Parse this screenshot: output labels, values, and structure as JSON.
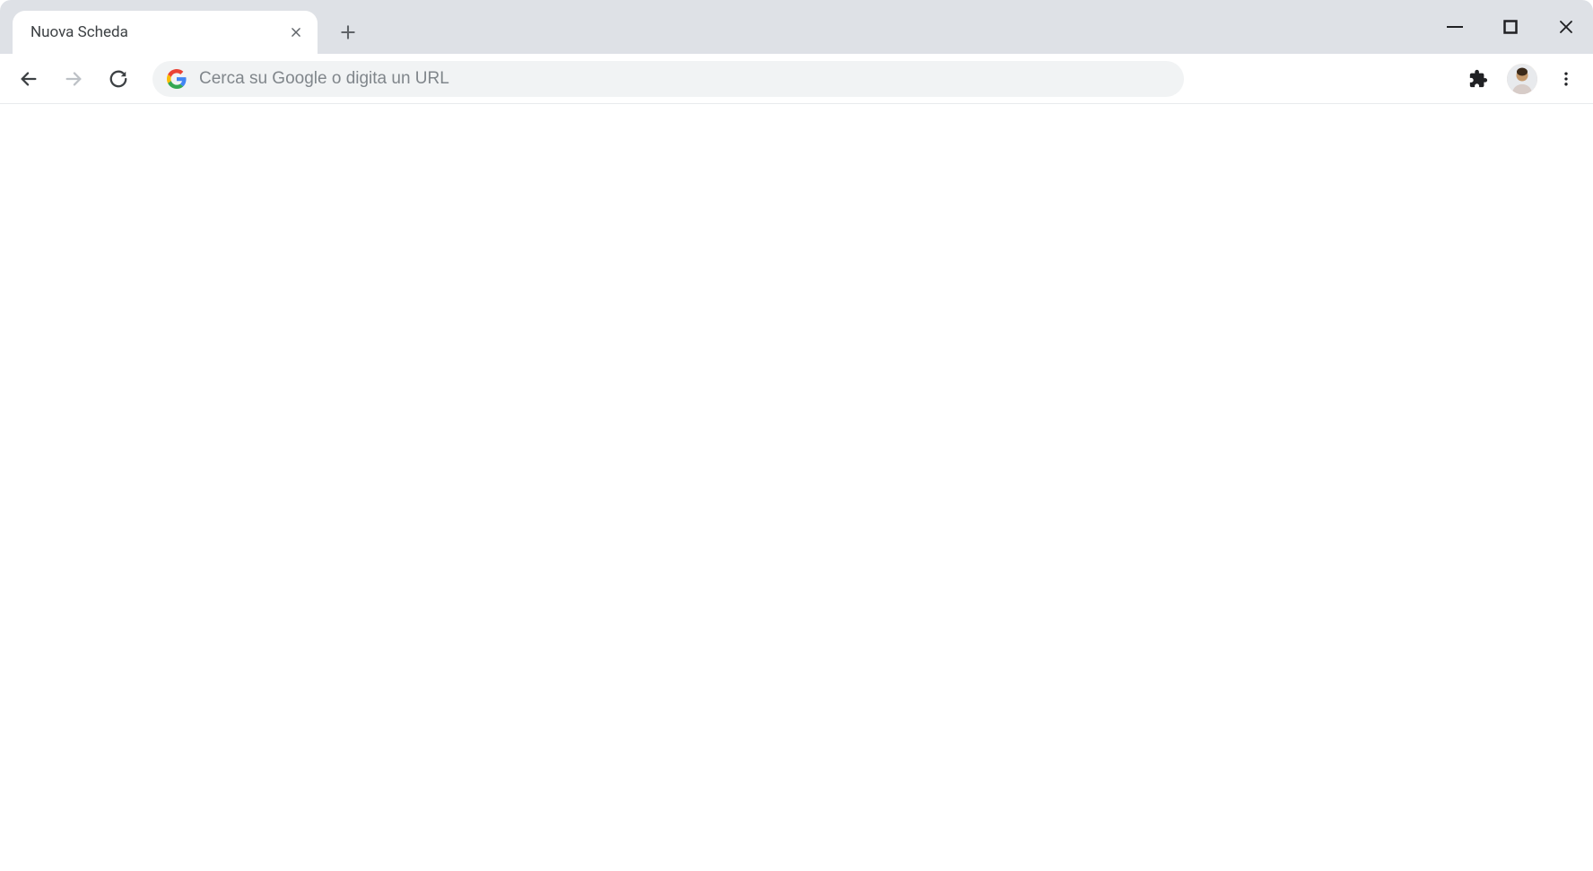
{
  "tab": {
    "title": "Nuova Scheda"
  },
  "omnibox": {
    "placeholder": "Cerca su Google o digita un URL",
    "value": ""
  },
  "icons": {
    "close_tab": "close-icon",
    "new_tab": "plus-icon",
    "minimize": "minimize-icon",
    "maximize": "maximize-icon",
    "close_window": "close-icon",
    "back": "arrow-left-icon",
    "forward": "arrow-right-icon",
    "reload": "reload-icon",
    "google": "google-g-icon",
    "extensions": "puzzle-piece-icon",
    "profile": "avatar-icon",
    "menu": "more-vertical-icon"
  },
  "nav": {
    "back_enabled": true,
    "forward_enabled": false,
    "reload_enabled": true
  }
}
